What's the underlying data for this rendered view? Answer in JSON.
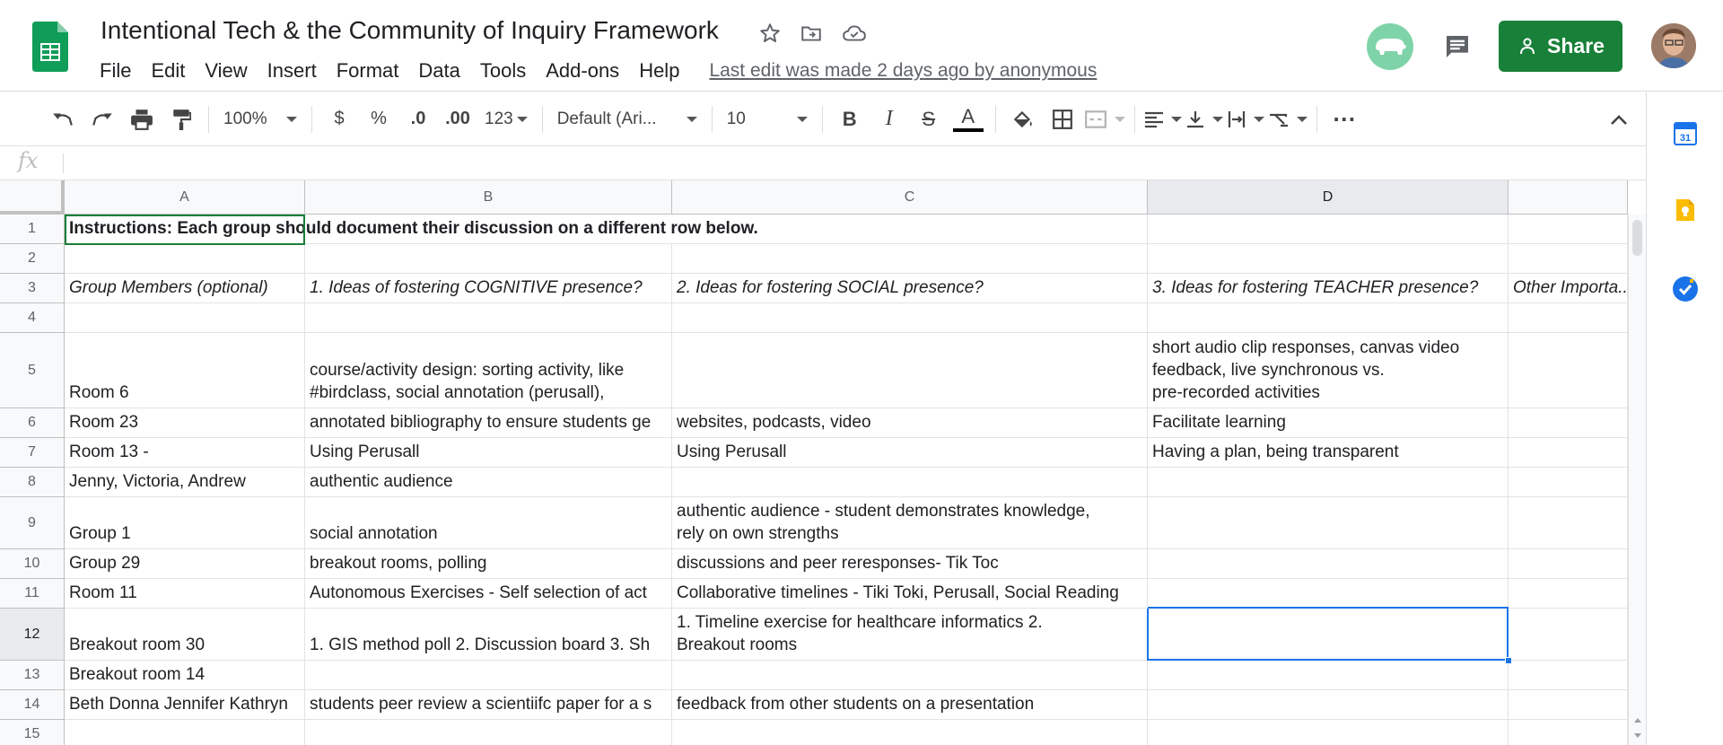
{
  "document": {
    "title": "Intentional Tech & the Community of Inquiry Framework",
    "last_edit": "Last edit was made 2 days ago by anonymous"
  },
  "menu": [
    "File",
    "Edit",
    "View",
    "Insert",
    "Format",
    "Data",
    "Tools",
    "Add-ons",
    "Help"
  ],
  "header": {
    "share_label": "Share"
  },
  "toolbar": {
    "zoom": "100%",
    "currency": "$",
    "percent": "%",
    "decrease_decimal": ".0",
    "increase_decimal": ".00",
    "more_formats": "123",
    "font": "Default (Ari...",
    "font_size": "10",
    "bold": "B",
    "italic": "I",
    "strike": "S",
    "text_color": "A",
    "more": "⋯"
  },
  "formula_bar": {
    "fx": "fx",
    "value": ""
  },
  "columns": [
    "A",
    "B",
    "C",
    "D"
  ],
  "rows": [
    "1",
    "2",
    "3",
    "4",
    "5",
    "6",
    "7",
    "8",
    "9",
    "10",
    "11",
    "12",
    "13",
    "14",
    "15"
  ],
  "cells": {
    "r1": {
      "a": "Instructions: Each group should document their discussion on a different row below."
    },
    "r3": {
      "a": "Group Members (optional)",
      "b": "1. Ideas of fostering COGNITIVE presence?",
      "c": "2. Ideas for fostering SOCIAL presence?",
      "d": "3. Ideas for fostering TEACHER presence?",
      "e": "Other Importa..."
    },
    "r5": {
      "a": "Room 6",
      "b": "course/activity design: sorting activity, like\n#birdclass, social annotation (perusall),",
      "d": "short audio clip responses, canvas video\nfeedback, live synchronous vs.\npre-recorded activities"
    },
    "r6": {
      "a": "Room 23",
      "b": "annotated bibliography to ensure students ge",
      "c": "websites, podcasts, video",
      "d": "Facilitate learning"
    },
    "r7": {
      "a": "Room 13 -",
      "b": "Using Perusall",
      "c": "Using Perusall",
      "d": "Having a plan, being transparent"
    },
    "r8": {
      "a": "Jenny, Victoria, Andrew",
      "b": "authentic audience"
    },
    "r9": {
      "a": "Group 1",
      "b": "social annotation",
      "c": "authentic audience - student demonstrates knowledge,\nrely on own strengths"
    },
    "r10": {
      "a": "Group 29",
      "b": "breakout rooms, polling",
      "c": "discussions and peer reresponses- Tik Toc"
    },
    "r11": {
      "a": "Room 11",
      "b": "Autonomous Exercises - Self selection of act",
      "c": "Collaborative timelines - Tiki Toki, Perusall, Social Reading"
    },
    "r12": {
      "a": "Breakout room 30",
      "b": "1. GIS method poll 2. Discussion board 3. Sh",
      "c": "1. Timeline exercise for healthcare informatics 2.\nBreakout rooms"
    },
    "r13": {
      "a": "Breakout room 14"
    },
    "r14": {
      "a": "Beth Donna Jennifer Kathryn",
      "b": "students peer review a scientiifc paper for a s",
      "c": "feedback from other students on a presentation"
    }
  },
  "colors": {
    "share": "#188038",
    "sheets_green": "#0f9d58",
    "selection_blue": "#1a73e8"
  }
}
